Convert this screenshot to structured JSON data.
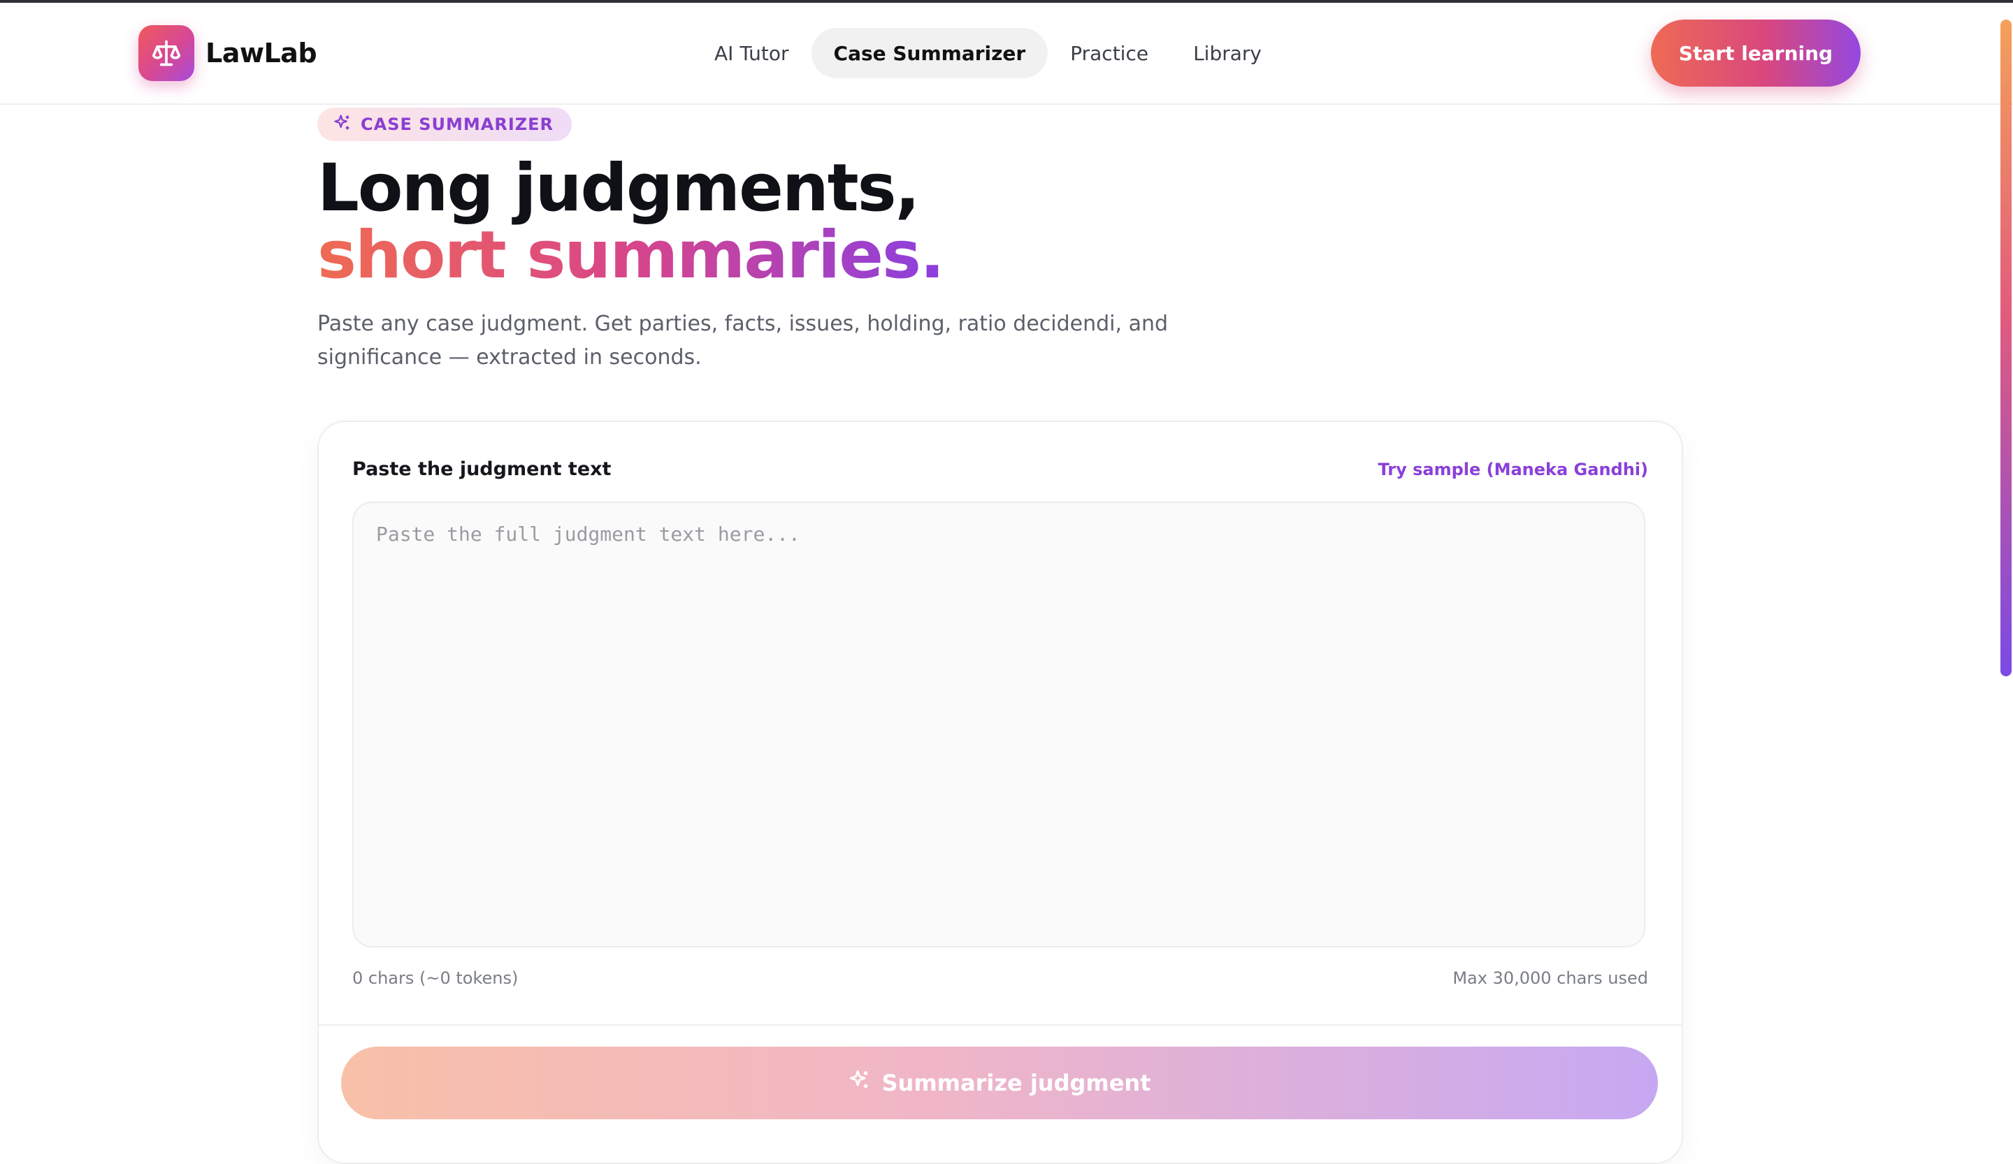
{
  "brand": {
    "name": "LawLab",
    "logo_icon": "scales-icon",
    "accent_start": "#ef6b52",
    "accent_mid": "#d8458a",
    "accent_end": "#8b3fe0"
  },
  "nav": {
    "items": [
      {
        "label": "AI Tutor",
        "active": false
      },
      {
        "label": "Case Summarizer",
        "active": true
      },
      {
        "label": "Practice",
        "active": false
      },
      {
        "label": "Library",
        "active": false
      }
    ]
  },
  "header": {
    "cta_label": "Start learning"
  },
  "hero": {
    "eyebrow": "CASE SUMMARIZER",
    "eyebrow_icon": "sparkles-icon",
    "headline_line1": "Long judgments,",
    "headline_line2": "short summaries.",
    "subtitle": "Paste any case judgment. Get parties, facts, issues, holding, ratio decidendi, and significance — extracted in seconds."
  },
  "form": {
    "label": "Paste the judgment text",
    "sample_link": "Try sample (Maneka Gandhi)",
    "textarea_value": "",
    "textarea_placeholder": "Paste the full judgment text here...",
    "char_count": "0 chars (~0 tokens)",
    "max_chars": "Max 30,000 chars used",
    "submit_label": "Summarize judgment",
    "submit_icon": "sparkles-icon"
  }
}
